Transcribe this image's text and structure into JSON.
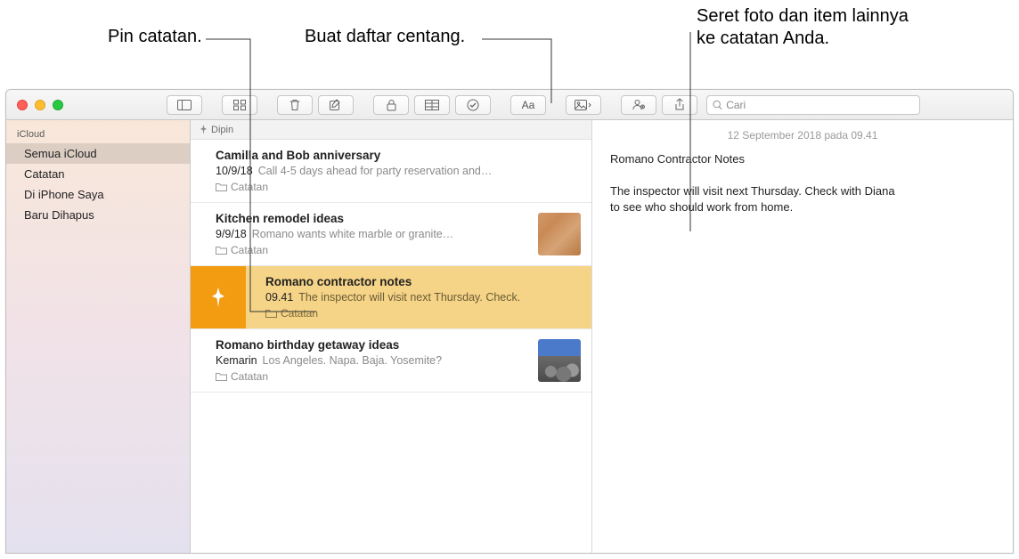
{
  "callouts": {
    "pin": "Pin catatan.",
    "checklist": "Buat daftar centang.",
    "drag": "Seret foto dan item lainnya\nke catatan Anda."
  },
  "toolbar": {
    "search_placeholder": "Cari"
  },
  "sidebar": {
    "section": "iCloud",
    "items": [
      "Semua iCloud",
      "Catatan",
      "Di iPhone Saya",
      "Baru Dihapus"
    ]
  },
  "notelist": {
    "pinned_header": "Dipin",
    "notes": [
      {
        "title": "Camilla and Bob anniversary",
        "date": "10/9/18",
        "preview": "Call 4-5 days ahead for party reservation and…",
        "folder": "Catatan",
        "thumb": null
      },
      {
        "title": "Kitchen remodel ideas",
        "date": "9/9/18",
        "preview": "Romano wants white marble or granite…",
        "folder": "Catatan",
        "thumb": "wood"
      },
      {
        "title": "Romano contractor notes",
        "date": "09.41",
        "preview": "The inspector will visit next Thursday. Check.",
        "folder": "Catatan",
        "thumb": null,
        "selected": true,
        "pinned": true
      },
      {
        "title": "Romano birthday getaway ideas",
        "date": "Kemarin",
        "preview": "Los Angeles. Napa. Baja. Yosemite?",
        "folder": "Catatan",
        "thumb": "rocks"
      }
    ]
  },
  "detail": {
    "timestamp": "12 September 2018  pada 09.41",
    "title": "Romano Contractor Notes",
    "body": "The inspector will visit next Thursday. Check with Diana to see who should work from home."
  }
}
